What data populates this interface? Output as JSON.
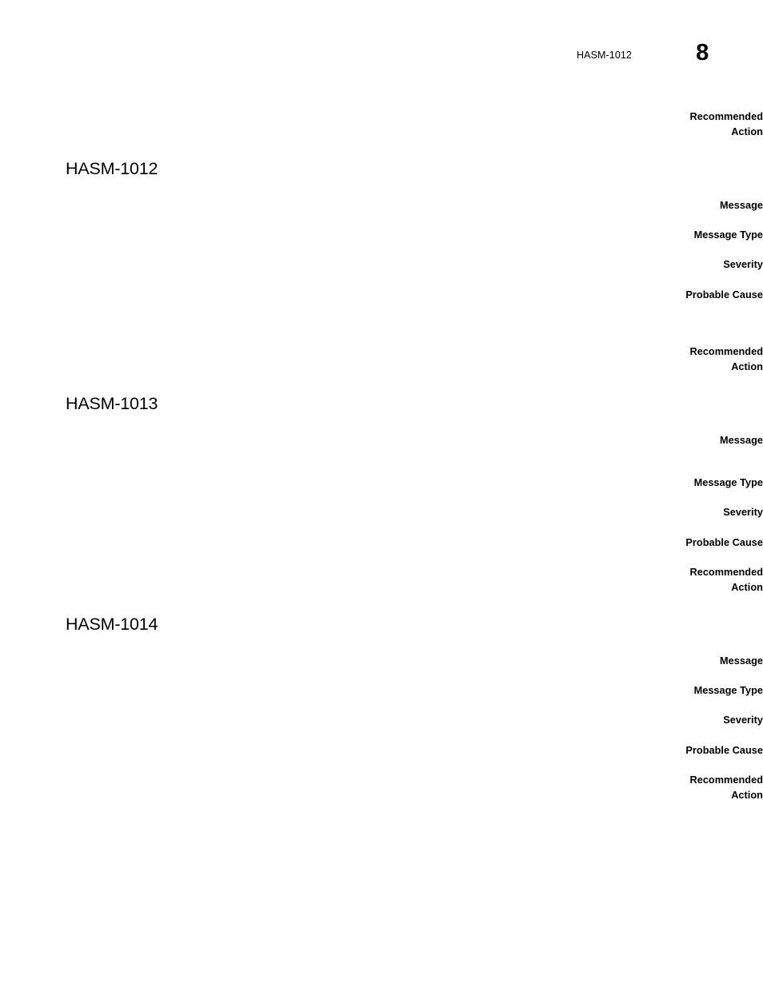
{
  "document": {
    "page_number": "8",
    "header_reference": "HASM-1012",
    "background_color": "#ffffff",
    "text_color": "#000000"
  },
  "labels": {
    "message": "Message",
    "message_type": "Message Type",
    "severity": "Severity",
    "probable_cause": "Probable Cause",
    "recommended_action": "Recommended\nAction"
  },
  "top_block": {
    "label": "Recommended\nAction",
    "value": ""
  },
  "sections": [
    {
      "heading": "HASM-1012",
      "fields": [
        {
          "label": "Message",
          "value": ""
        },
        {
          "label": "Message Type",
          "value": ""
        },
        {
          "label": "Severity",
          "value": ""
        },
        {
          "label": "Probable Cause",
          "value": ""
        },
        {
          "label": "Recommended\nAction",
          "value": ""
        }
      ]
    },
    {
      "heading": "HASM-1013",
      "fields": [
        {
          "label": "Message",
          "value": ""
        },
        {
          "label": "Message Type",
          "value": ""
        },
        {
          "label": "Severity",
          "value": ""
        },
        {
          "label": "Probable Cause",
          "value": ""
        },
        {
          "label": "Recommended\nAction",
          "value": ""
        }
      ]
    },
    {
      "heading": "HASM-1014",
      "fields": [
        {
          "label": "Message",
          "value": ""
        },
        {
          "label": "Message Type",
          "value": ""
        },
        {
          "label": "Severity",
          "value": ""
        },
        {
          "label": "Probable Cause",
          "value": ""
        },
        {
          "label": "Recommended\nAction",
          "value": ""
        }
      ]
    }
  ]
}
